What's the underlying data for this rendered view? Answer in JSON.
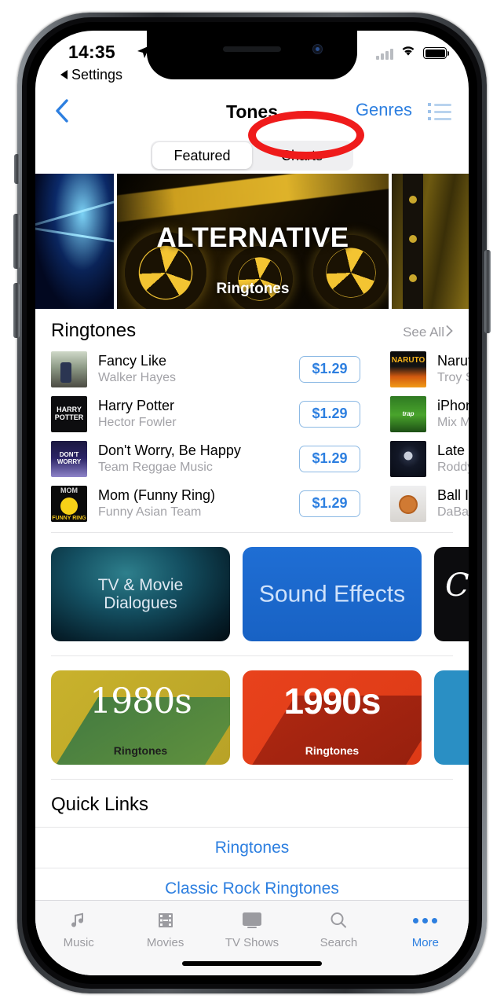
{
  "status_bar": {
    "time": "14:35",
    "location_icon": "location-arrow-icon",
    "signal_icon": "cellular-signal-icon",
    "wifi_icon": "wifi-icon",
    "battery_icon": "battery-full-icon"
  },
  "back_to_app": {
    "label": "Settings",
    "icon": "back-triangle-icon"
  },
  "nav": {
    "back_icon": "chevron-left-icon",
    "title": "Tones",
    "genres_label": "Genres",
    "list_icon": "list-view-icon"
  },
  "segmented": {
    "items": [
      {
        "label": "Featured",
        "selected": true
      },
      {
        "label": "Charts",
        "selected": false
      }
    ]
  },
  "hero": {
    "cards": [
      {
        "title": "",
        "subtitle": "",
        "art": "blue-laser-art"
      },
      {
        "title": "ALTERNATIVE",
        "subtitle": "Ringtones",
        "art": "alternative-radiation-art"
      },
      {
        "title": "",
        "subtitle": "",
        "art": "gold-speaker-art"
      }
    ]
  },
  "ringtones_section": {
    "title": "Ringtones",
    "see_all_label": "See All",
    "see_all_icon": "chevron-right-icon",
    "column_one": [
      {
        "name": "Fancy Like",
        "artist": "Walker Hayes",
        "price": "$1.29",
        "art": "fancy-like-art"
      },
      {
        "name": "Harry Potter",
        "artist": "Hector Fowler",
        "price": "$1.29",
        "art": "harry-potter-art"
      },
      {
        "name": "Don't Worry, Be Happy",
        "artist": "Team Reggae Music",
        "price": "$1.29",
        "art": "dont-worry-be-happy-art"
      },
      {
        "name": "Mom (Funny Ring)",
        "artist": "Funny Asian Team",
        "price": "$1.29",
        "art": "mom-funny-ring-art"
      }
    ],
    "column_two": [
      {
        "name": "Naruto (Trap",
        "artist": "Troy Simon",
        "art": "naruto-art"
      },
      {
        "name": "iPhone Openi",
        "artist": "Mix Max Remi",
        "art": "iphone-opening-art"
      },
      {
        "name": "Late at Night",
        "artist": "Roddy Ricch",
        "art": "late-at-night-art"
      },
      {
        "name": "Ball If I Want",
        "artist": "DaBaby",
        "art": "ball-if-i-want-art"
      }
    ]
  },
  "category_cards_row_one": [
    {
      "label": "TV & Movie Dialogues",
      "style": "teal"
    },
    {
      "label": "Sound Effects",
      "style": "blue"
    },
    {
      "label": "",
      "style": "black"
    }
  ],
  "category_cards_row_two": [
    {
      "label": "1980s",
      "sublabel": "Ringtones",
      "style": "olive"
    },
    {
      "label": "1990s",
      "sublabel": "Ringtones",
      "style": "red"
    },
    {
      "label": "",
      "sublabel": "",
      "style": "blue"
    }
  ],
  "quick_links": {
    "title": "Quick Links",
    "items": [
      {
        "label": "Ringtones"
      },
      {
        "label": "Classic Rock Ringtones"
      }
    ]
  },
  "tab_bar": {
    "tabs": [
      {
        "label": "Music",
        "icon": "music-note-icon",
        "active": false
      },
      {
        "label": "Movies",
        "icon": "film-strip-icon",
        "active": false
      },
      {
        "label": "TV Shows",
        "icon": "television-icon",
        "active": false
      },
      {
        "label": "Search",
        "icon": "magnifier-icon",
        "active": false
      },
      {
        "label": "More",
        "icon": "ellipsis-icon",
        "active": true
      }
    ]
  },
  "annotation": {
    "shape": "ellipse",
    "color": "#ef1b1b",
    "targets": "Charts"
  },
  "colors": {
    "accent": "#2d7fe0",
    "annotation": "#ef1b1b",
    "muted": "#9b9ba0"
  }
}
